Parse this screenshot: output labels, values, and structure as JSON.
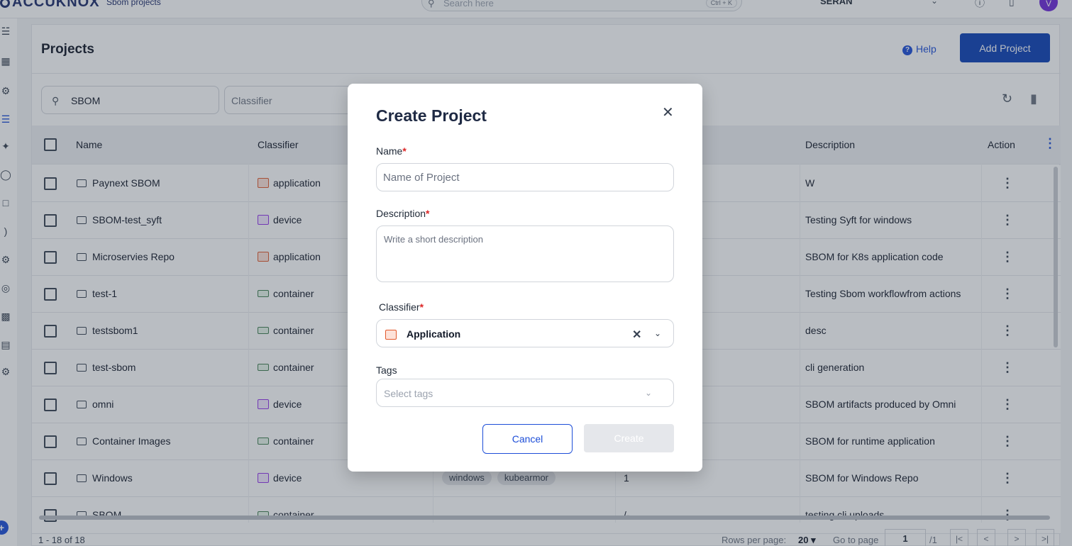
{
  "topbar": {
    "logo": "ACCUKNOX",
    "breadcrumb": "Sbom projects",
    "search_placeholder": "Search here",
    "shortcut": "Ctrl + K",
    "tenant": "SERAN",
    "avatar_letter": "V"
  },
  "page": {
    "title": "Projects",
    "help_label": "Help",
    "add_project_label": "Add Project",
    "search_value": "SBOM",
    "classifier_placeholder": "Classifier"
  },
  "table": {
    "columns": {
      "name": "Name",
      "classifier": "Classifier",
      "description": "Description",
      "action": "Action"
    },
    "rows": [
      {
        "name": "Paynext SBOM",
        "classifier": "application",
        "tags": [],
        "version": "",
        "description": "W"
      },
      {
        "name": "SBOM-test_syft",
        "classifier": "device",
        "tags": [],
        "version": "",
        "description": "Testing Syft for windows"
      },
      {
        "name": "Microservies Repo",
        "classifier": "application",
        "tags": [],
        "version": "",
        "description": "SBOM for K8s application code"
      },
      {
        "name": "test-1",
        "classifier": "container",
        "tags": [],
        "version": "",
        "description": "Testing Sbom workflowfrom actions"
      },
      {
        "name": "testsbom1",
        "classifier": "container",
        "tags": [],
        "version": "",
        "description": "desc"
      },
      {
        "name": "test-sbom",
        "classifier": "container",
        "tags": [],
        "version": "",
        "description": "cli generation"
      },
      {
        "name": "omni",
        "classifier": "device",
        "tags": [],
        "version": "",
        "description": "SBOM artifacts produced by Omni"
      },
      {
        "name": "Container Images",
        "classifier": "container",
        "tags": [],
        "version": "",
        "description": "SBOM for runtime application"
      },
      {
        "name": "Windows",
        "classifier": "device",
        "tags": [
          "windows",
          "kubearmor"
        ],
        "version": "1",
        "description": "SBOM for Windows Repo"
      },
      {
        "name": "SBOM",
        "classifier": "container",
        "tags": [],
        "version": "/-",
        "description": "testing cli uploads"
      }
    ]
  },
  "footer": {
    "count": "1 - 18 of 18",
    "rows_per_page_label": "Rows per page:",
    "rows_per_page_value": "20",
    "goto_label": "Go to page",
    "page_value": "1",
    "total_pages": "/1"
  },
  "modal": {
    "title": "Create Project",
    "name_label": "Name",
    "name_placeholder": "Name of Project",
    "description_label": "Description",
    "description_placeholder": "Write a short description",
    "classifier_label": "Classifier",
    "classifier_value": "Application",
    "tags_label": "Tags",
    "tags_placeholder": "Select tags",
    "required_mark": "*",
    "cancel_label": "Cancel",
    "create_label": "Create"
  },
  "colors": {
    "primary": "#0b3fb5",
    "required": "#dc2626",
    "application": "#e2582b",
    "device": "#9333ea",
    "container": "#3f7d4f"
  }
}
